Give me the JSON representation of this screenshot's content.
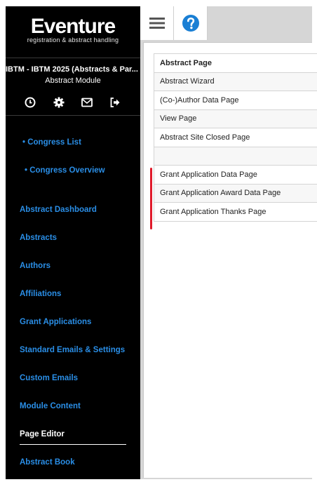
{
  "brand": {
    "name": "Eventure",
    "tagline": "registration & abstract handling"
  },
  "event": {
    "name": "IBTM - IBTM 2025 (Abstracts & Par...",
    "module": "Abstract Module"
  },
  "header_icons": [
    "clock-icon",
    "gear-icon",
    "envelope-icon",
    "logout-icon"
  ],
  "nav": {
    "congress_list": "• Congress List",
    "congress_overview": "• Congress Overview",
    "items": [
      "Abstract Dashboard",
      "Abstracts",
      "Authors",
      "Affiliations",
      "Grant Applications",
      "Standard Emails & Settings",
      "Custom Emails",
      "Module Content",
      "Page Editor",
      "Abstract Book"
    ],
    "active": "Page Editor"
  },
  "toolbar": {
    "menu_icon": "hamburger-icon",
    "help_icon": "help-icon"
  },
  "pages_table": {
    "header": "Abstract Page",
    "rows": [
      "Abstract Wizard",
      "(Co-)Author Data Page",
      "View Page",
      "Abstract Site Closed Page",
      "",
      "Grant Application Data Page",
      "Grant Application Award Data Page",
      "Grant Application Thanks Page"
    ]
  },
  "colors": {
    "sidebar_bg": "#000000",
    "link": "#2a8ee6",
    "help": "#1a7fd4",
    "highlight": "#e01a2b"
  }
}
